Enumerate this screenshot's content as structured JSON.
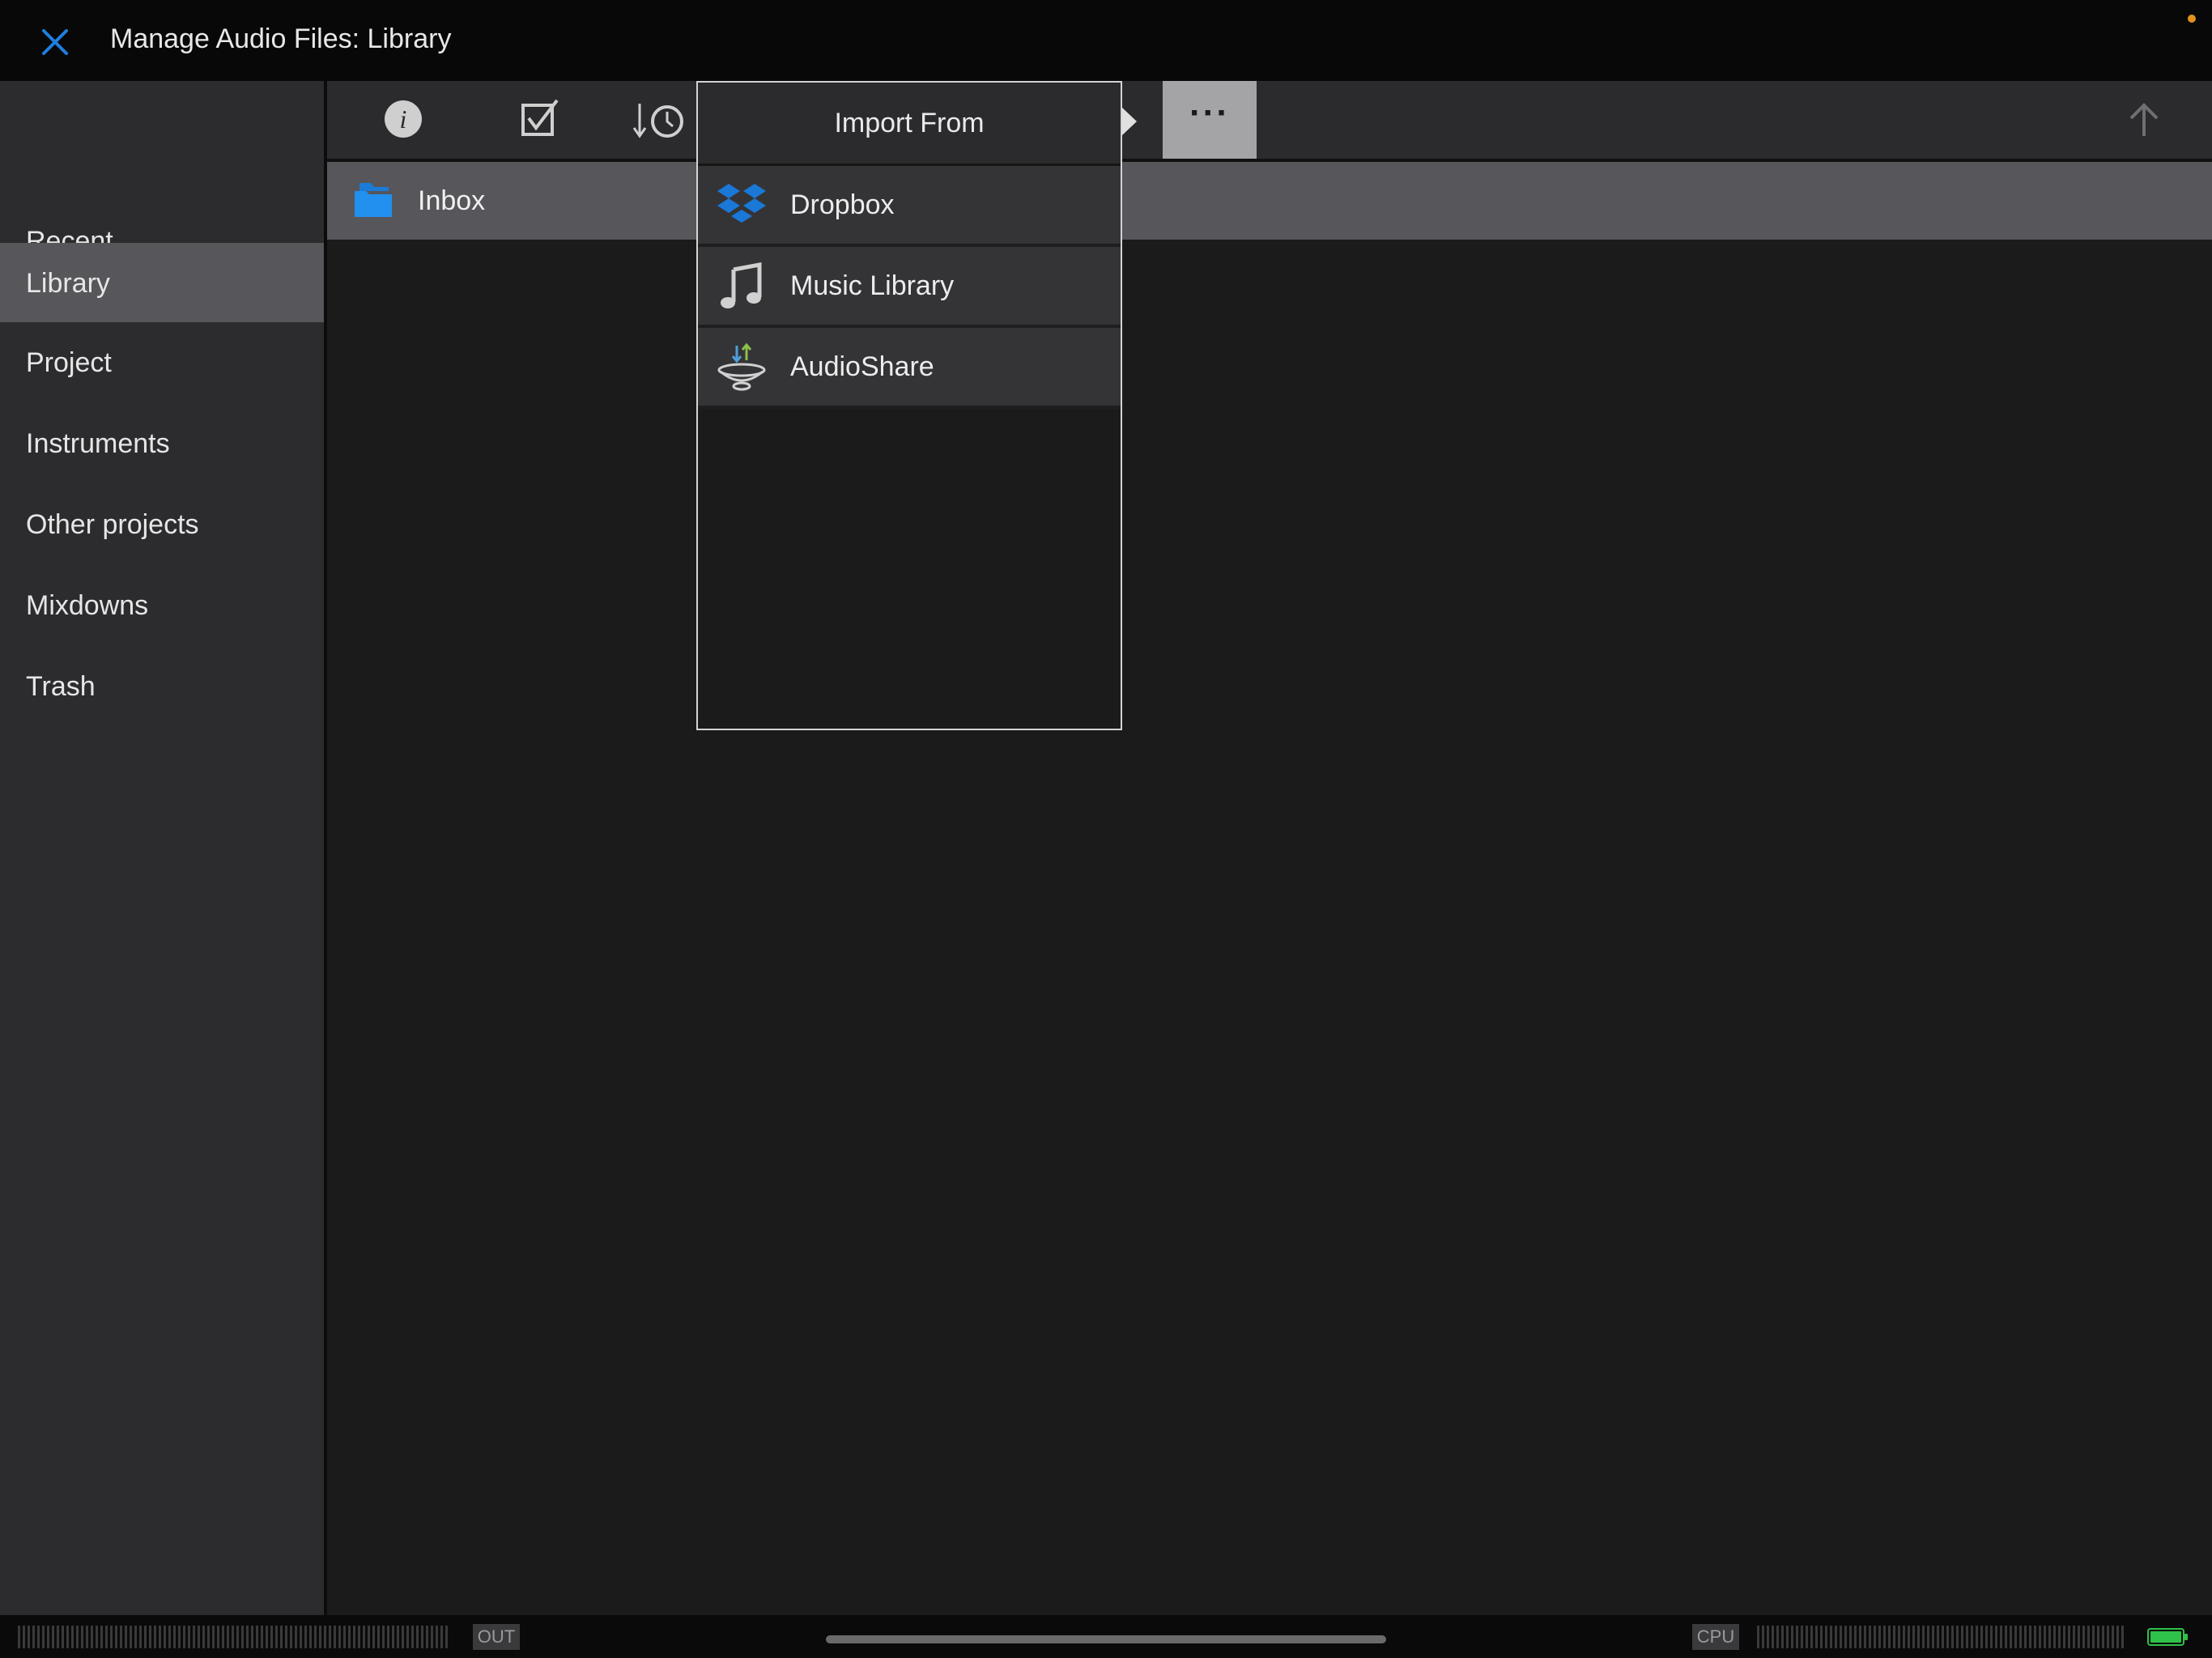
{
  "header": {
    "title": "Manage Audio Files: Library"
  },
  "sidebar": {
    "items": [
      {
        "label": "Recent"
      },
      {
        "label": "Library",
        "active": true
      },
      {
        "label": "Project"
      },
      {
        "label": "Instruments"
      },
      {
        "label": "Other projects"
      },
      {
        "label": "Mixdowns"
      },
      {
        "label": "Trash"
      }
    ]
  },
  "toolbar": {
    "buttons": [
      "info-icon",
      "select-checkbox-icon",
      "sort-by-date-icon",
      "more-icon",
      "up-arrow-icon"
    ],
    "more_label": "···"
  },
  "files": [
    {
      "name": "Inbox",
      "icon": "folder-icon"
    }
  ],
  "import_popover": {
    "title": "Import From",
    "items": [
      {
        "label": "Dropbox",
        "icon": "dropbox-icon"
      },
      {
        "label": "Music Library",
        "icon": "music-note-icon"
      },
      {
        "label": "AudioShare",
        "icon": "audioshare-icon"
      }
    ]
  },
  "bottom_bar": {
    "out_label": "OUT",
    "cpu_label": "CPU"
  },
  "colors": {
    "accent": "#1e7fe0",
    "active_row": "#56565b",
    "battery": "#2fc24a",
    "status_dot": "#e2921b"
  }
}
